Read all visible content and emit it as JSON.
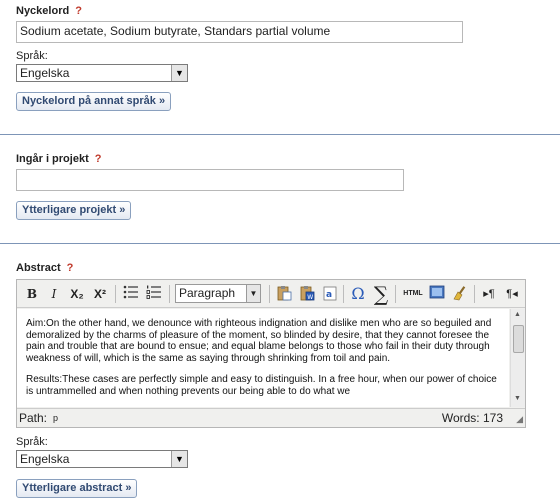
{
  "keywords": {
    "label": "Nyckelord",
    "help": "?",
    "value": "Sodium acetate, Sodium butyrate, Standars partial volume",
    "language_label": "Språk:",
    "language_value": "Engelska",
    "other_lang_button": "Nyckelord på annat språk »"
  },
  "project": {
    "label": "Ingår i projekt",
    "help": "?",
    "value": "",
    "more_button": "Ytterligare projekt »"
  },
  "abstract": {
    "label": "Abstract",
    "help": "?",
    "toolbar": {
      "bold": "B",
      "italic": "I",
      "subscript": "X₂",
      "superscript": "X²",
      "format_select": "Paragraph"
    },
    "paragraphs": [
      "Aim:On the other hand, we denounce with righteous indignation and dislike men who are so beguiled and demoralized by the charms of pleasure of the moment, so blinded by desire, that they cannot foresee the pain and trouble that are bound to ensue; and equal blame belongs to those who fail in their duty through weakness of will, which is the same as saying through shrinking from toil and pain.",
      "Results:These cases are perfectly simple and easy to distinguish. In a free hour, when our power of choice is untrammelled and when nothing prevents our being able to do what we"
    ],
    "path_label": "Path:",
    "path_value": "p",
    "words_label": "Words: 173",
    "language_label": "Språk:",
    "language_value": "Engelska",
    "more_button": "Ytterligare abstract »"
  },
  "colors": {
    "separator": "#7d95b7",
    "help_mark": "#c0392b",
    "button_text": "#314a72"
  }
}
